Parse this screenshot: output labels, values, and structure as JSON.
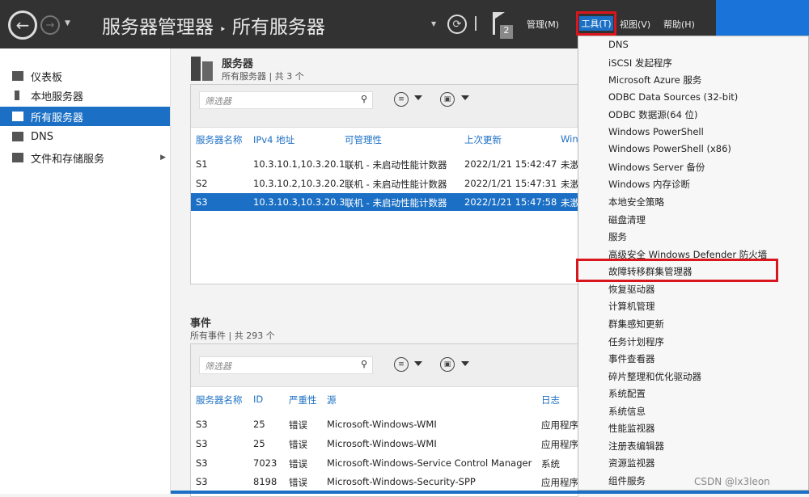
{
  "header": {
    "title": "服务器管理器",
    "breadcrumb_sep": "‣",
    "subtitle": "所有服务器",
    "flag_count": "2",
    "menus": [
      "管理(M)",
      "工具(T)",
      "视图(V)",
      "帮助(H)"
    ]
  },
  "sidebar": {
    "items": [
      {
        "label": "仪表板"
      },
      {
        "label": "本地服务器"
      },
      {
        "label": "所有服务器"
      },
      {
        "label": "DNS"
      },
      {
        "label": "文件和存储服务"
      }
    ]
  },
  "servers": {
    "title": "服务器",
    "subtitle": "所有服务器 | 共 3 个",
    "filter_placeholder": "筛选器",
    "columns": [
      "服务器名称",
      "IPv4 地址",
      "可管理性",
      "上次更新",
      "Win"
    ],
    "rows": [
      [
        "S1",
        "10.3.10.1,10.3.20.1",
        "联机 - 未启动性能计数器",
        "2022/1/21 15:42:47",
        "未激"
      ],
      [
        "S2",
        "10.3.10.2,10.3.20.2",
        "联机 - 未启动性能计数器",
        "2022/1/21 15:47:31",
        "未激"
      ],
      [
        "S3",
        "10.3.10.3,10.3.20.3",
        "联机 - 未启动性能计数器",
        "2022/1/21 15:47:58",
        "未激"
      ]
    ]
  },
  "events": {
    "title": "事件",
    "subtitle": "所有事件 | 共 293 个",
    "filter_placeholder": "筛选器",
    "columns": [
      "服务器名称",
      "ID",
      "严重性",
      "源",
      "日志"
    ],
    "rows": [
      [
        "S3",
        "25",
        "错误",
        "Microsoft-Windows-WMI",
        "应用程序"
      ],
      [
        "S3",
        "25",
        "错误",
        "Microsoft-Windows-WMI",
        "应用程序"
      ],
      [
        "S3",
        "7023",
        "错误",
        "Microsoft-Windows-Service Control Manager",
        "系统"
      ],
      [
        "S3",
        "8198",
        "错误",
        "Microsoft-Windows-Security-SPP",
        "应用程序"
      ]
    ]
  },
  "tools_menu": [
    "DNS",
    "iSCSI 发起程序",
    "Microsoft Azure 服务",
    "ODBC Data Sources (32-bit)",
    "ODBC 数据源(64 位)",
    "Windows PowerShell",
    "Windows PowerShell (x86)",
    "Windows Server 备份",
    "Windows 内存诊断",
    "本地安全策略",
    "磁盘清理",
    "服务",
    "高级安全 Windows Defender 防火墙",
    "故障转移群集管理器",
    "恢复驱动器",
    "计算机管理",
    "群集感知更新",
    "任务计划程序",
    "事件查看器",
    "碎片整理和优化驱动器",
    "系统配置",
    "系统信息",
    "性能监视器",
    "注册表编辑器",
    "资源监视器",
    "组件服务"
  ],
  "watermark": "CSDN @lx3leon",
  "colors": {
    "accent": "#1b6fc4",
    "highlight": "#d9161e",
    "header": "#323232"
  }
}
